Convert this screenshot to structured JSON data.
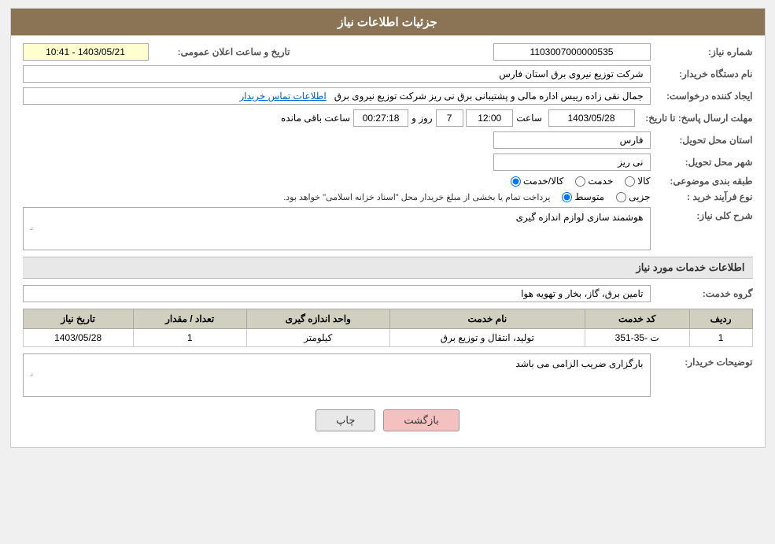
{
  "header": {
    "title": "جزئیات اطلاعات نیاز"
  },
  "fields": {
    "shomara_label": "شماره نیاز:",
    "shomara_value": "1103007000000535",
    "name_dastgah_label": "نام دستگاه خریدار:",
    "name_dastgah_value": "شرکت توزیع نیروی برق استان فارس",
    "ijad_label": "ایجاد کننده درخواست:",
    "ijad_value": "جمال نقی زاده رییس اداره مالی و پشتیبانی برق نی ریز شرکت توزیع نیروی برق",
    "ijad_link": "اطلاعات تماس خریدار",
    "mohlat_label": "مهلت ارسال پاسخ: تا تاریخ:",
    "tarikh_value": "1403/05/28",
    "saat_label": "ساعت",
    "saat_value": "12:00",
    "roz_label": "روز و",
    "roz_value": "7",
    "mande_label": "ساعت باقی مانده",
    "mande_value": "00:27:18",
    "tarikh_elam_label": "تاریخ و ساعت اعلان عمومی:",
    "tarikh_elam_value": "1403/05/21 - 10:41",
    "ostan_label": "استان محل تحویل:",
    "ostan_value": "فارس",
    "shahr_label": "شهر محل تحویل:",
    "shahr_value": "نی ریز",
    "tabaghebandi_label": "طبقه بندی موضوعی:",
    "kala_label": "کالا",
    "khedmat_label": "خدمت",
    "kala_khedmat_label": "کالا/خدمت",
    "noefrayand_label": "نوع فرآیند خرید :",
    "jozei_label": "جزیی",
    "motevaset_label": "متوسط",
    "noefrayand_desc": "پرداخت تمام یا بخشی از مبلغ خریدار محل \"اسناد خزانه اسلامی\" خواهد بود.",
    "sharh_label": "شرح کلی نیاز:",
    "sharh_value": "هوشمند سازی لوازم اندازه گیری",
    "khadamat_label": "اطلاعات خدمات مورد نیاز",
    "gorohe_khedmat_label": "گروه خدمت:",
    "gorohe_khedmat_value": "تامین برق، گاز، بخار و تهویه هوا",
    "table": {
      "headers": [
        "ردیف",
        "کد خدمت",
        "نام خدمت",
        "واحد اندازه گیری",
        "تعداد / مقدار",
        "تاریخ نیاز"
      ],
      "rows": [
        {
          "radif": "1",
          "kod": "ت -35-351",
          "name": "تولید، انتقال و توزیع برق",
          "vahed": "کیلومتر",
          "tedad": "1",
          "tarikh": "1403/05/28"
        }
      ]
    },
    "toseih_label": "توضیحات خریدار:",
    "toseih_value": "بارگزاری ضریب الزامی می باشد"
  },
  "buttons": {
    "chap": "چاپ",
    "bazgasht": "بازگشت"
  }
}
